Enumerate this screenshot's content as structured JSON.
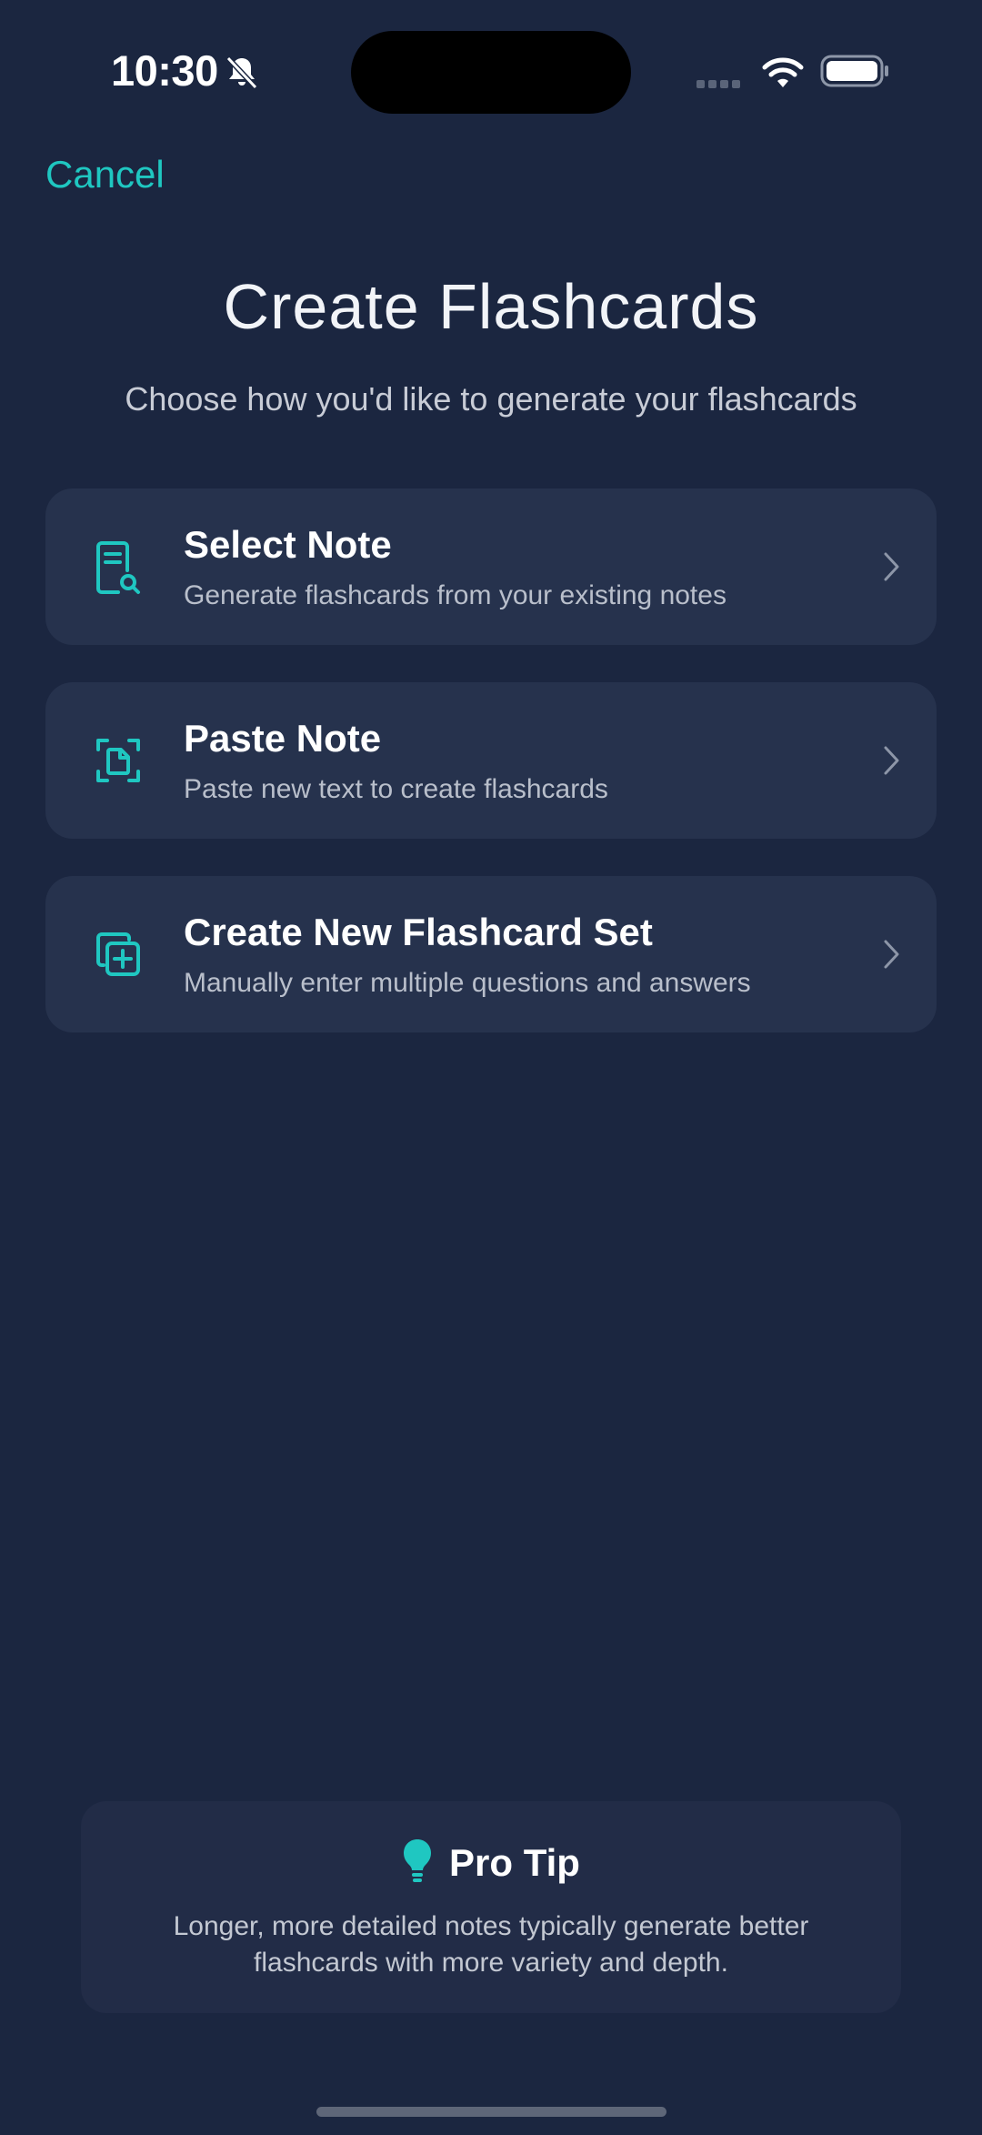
{
  "status_bar": {
    "time": "10:30"
  },
  "nav": {
    "cancel_label": "Cancel"
  },
  "header": {
    "title": "Create Flashcards",
    "subtitle": "Choose how you'd like to generate your flashcards"
  },
  "options": [
    {
      "title": "Select Note",
      "description": "Generate flashcards from your existing notes",
      "icon": "document-search-icon"
    },
    {
      "title": "Paste Note",
      "description": "Paste new text to create flashcards",
      "icon": "document-scan-icon"
    },
    {
      "title": "Create New Flashcard Set",
      "description": "Manually enter multiple questions and answers",
      "icon": "add-copy-icon"
    }
  ],
  "tip": {
    "title": "Pro Tip",
    "text": "Longer, more detailed notes typically generate better flashcards with more variety and depth.",
    "icon": "lightbulb-icon"
  },
  "colors": {
    "background": "#1b2640",
    "card": "#26324d",
    "accent": "#1fc7c1"
  }
}
